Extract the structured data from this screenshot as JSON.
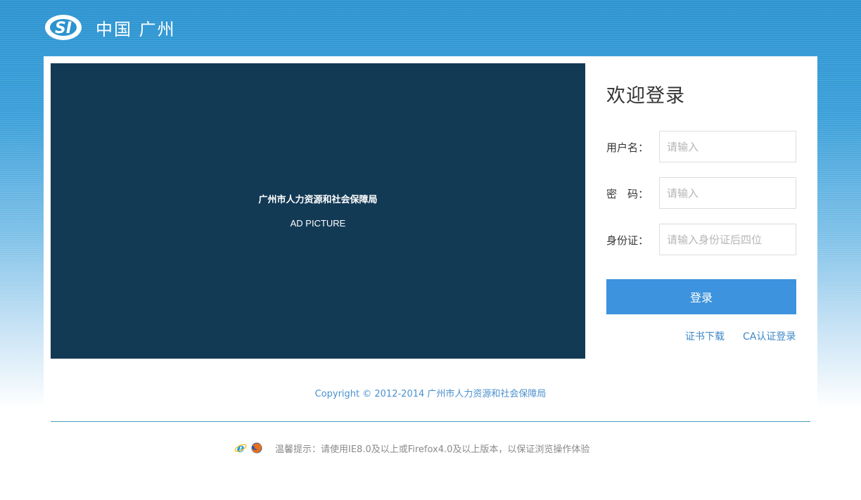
{
  "header": {
    "logo_text": "SI",
    "title": "中国 广州"
  },
  "ad": {
    "org_name": "广州市人力资源和社会保障局",
    "caption": "AD PICTURE"
  },
  "login": {
    "title": "欢迎登录",
    "username": {
      "label": "用户名：",
      "value": "",
      "placeholder": "请输入"
    },
    "password": {
      "label": "密　码：",
      "value": "",
      "placeholder": "请输入"
    },
    "id_card": {
      "label": "身份证：",
      "value": "",
      "placeholder": "请输入身份证后四位"
    },
    "submit_label": "登录",
    "links": {
      "cert_download": "证书下载",
      "ca_login": "CA认证登录"
    }
  },
  "footer": {
    "copyright": "Copyright © 2012-2014  广州市人力资源和社会保障局",
    "notice": "温馨提示：请使用IE8.0及以上或Firefox4.0及以上版本，以保证浏览操作体验"
  },
  "icons": {
    "logo": "si-logo-icon",
    "ie": "ie-browser-icon",
    "firefox": "firefox-browser-icon"
  },
  "colors": {
    "header_blue": "#2b93d0",
    "ad_bg": "#133a55",
    "button": "#3d93dd",
    "link": "#3d87c9"
  }
}
